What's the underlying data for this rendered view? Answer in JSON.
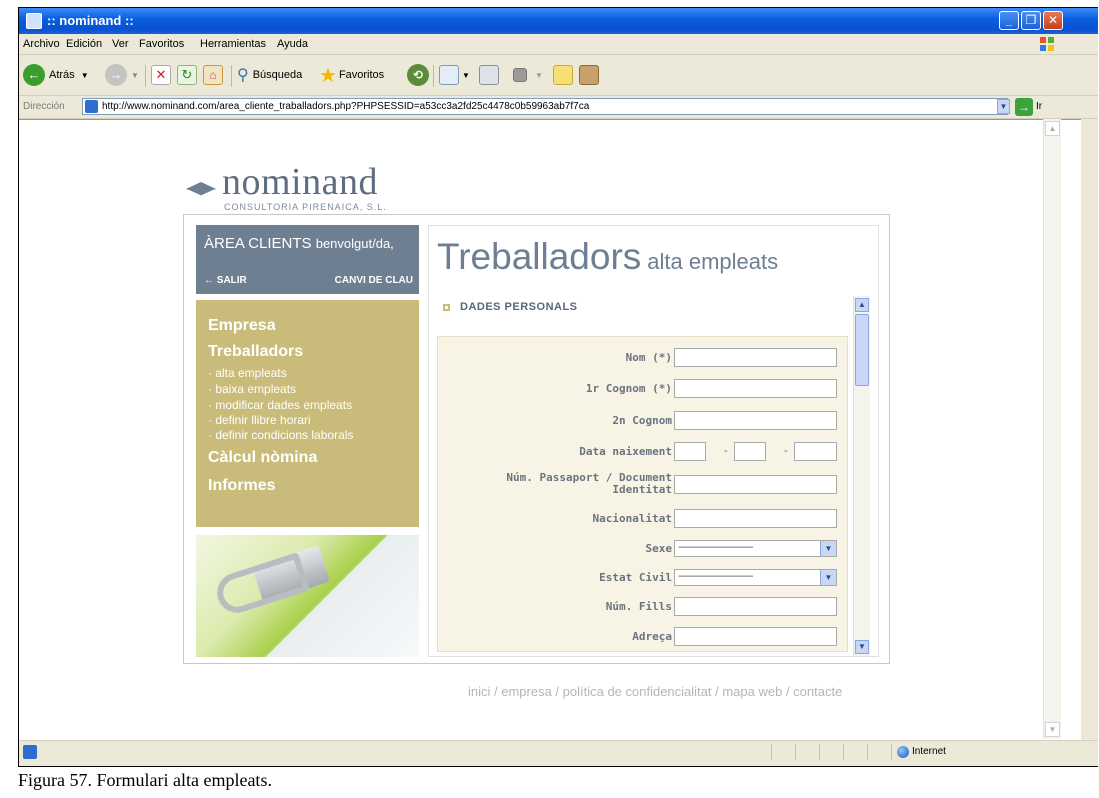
{
  "window": {
    "title": ":: nominand ::"
  },
  "menubar": [
    "Archivo",
    "Edición",
    "Ver",
    "Favoritos",
    "Herramientas",
    "Ayuda"
  ],
  "toolbar": {
    "back": "Atrás",
    "search": "Búsqueda",
    "favorites": "Favoritos"
  },
  "address": {
    "label": "Dirección",
    "url": "http://www.nominand.com/area_cliente_traballadors.php?PHPSESSID=a53cc3a2fd25c4478c0b59963ab7f7ca",
    "go": "Ir"
  },
  "logo": {
    "name": "nominand",
    "sub": "CONSULTORIA PIRENAICA, S.L."
  },
  "area": {
    "title": "ÀREA CLIENTS",
    "greeting": "benvolgut/da,",
    "salir": "← SALIR",
    "canvi": "CANVI DE CLAU"
  },
  "nav": {
    "empresa": "Empresa",
    "treballadors": "Treballadors",
    "sub": [
      "· alta empleats",
      "· baixa empleats",
      "· modificar dades empleats",
      "· definir llibre horari",
      "· definir condicions laborals"
    ],
    "calcul": "Càlcul nòmina",
    "informes": "Informes"
  },
  "page": {
    "title": "Treballadors",
    "subtitle": "alta empleats",
    "section": "DADES PERSONALS"
  },
  "form": {
    "labels": [
      "Nom (*)",
      "1r Cognom (*)",
      "2n Cognom",
      "Data naixement",
      "Núm. Passaport / Document",
      "Identitat",
      "Nacionalitat",
      "Sexe",
      "Estat Civil",
      "Núm. Fills",
      "Adreça"
    ],
    "date_separator": "-",
    "select_placeholder": "--------------------------------"
  },
  "footer": "inici / empresa / política de confidencialitat / mapa web / contacte",
  "status": {
    "zone": "Internet"
  },
  "caption": "Figura 57. Formulari alta empleats.",
  "colors": {
    "titlebar": "#0a5fe0",
    "area_bg": "#6e7f92",
    "menu_bg": "#c9bc7b",
    "title_text": "#6d7f94",
    "form_bg": "#f7f3e5"
  }
}
